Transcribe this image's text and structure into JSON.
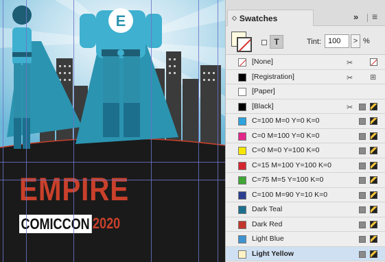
{
  "canvas": {
    "title_line1": "EMPIRE",
    "title_line2": "COMICCON",
    "title_year": "2020",
    "hero_emblem": "E"
  },
  "panel": {
    "tab_label": "Swatches",
    "tab_icon": "◇",
    "collapse_label": "»",
    "menu_label": "≡",
    "format_text_label": "T",
    "tint_label": "Tint:",
    "tint_value": "100",
    "tint_arrow": ">",
    "tint_unit": "%"
  },
  "swatches": [
    {
      "name": "[None]",
      "color": "none",
      "indicators": [
        "scissors-icon",
        "none-icon"
      ]
    },
    {
      "name": "[Registration]",
      "color": "#000000",
      "indicators": [
        "scissors-icon",
        "registration-icon"
      ]
    },
    {
      "name": "[Paper]",
      "color": "#ffffff",
      "indicators": []
    },
    {
      "name": "[Black]",
      "color": "#000000",
      "indicators": [
        "scissors-icon",
        "process-icon",
        "cmyk-icon"
      ]
    },
    {
      "name": "C=100 M=0 Y=0 K=0",
      "color": "#2ea3dc",
      "indicators": [
        "process-icon",
        "cmyk-icon"
      ]
    },
    {
      "name": "C=0 M=100 Y=0 K=0",
      "color": "#e2268a",
      "indicators": [
        "process-icon",
        "cmyk-icon"
      ]
    },
    {
      "name": "C=0 M=0 Y=100 K=0",
      "color": "#f5e600",
      "indicators": [
        "process-icon",
        "cmyk-icon"
      ]
    },
    {
      "name": "C=15 M=100 Y=100 K=0",
      "color": "#d52630",
      "indicators": [
        "process-icon",
        "cmyk-icon"
      ]
    },
    {
      "name": "C=75 M=5 Y=100 K=0",
      "color": "#3fa535",
      "indicators": [
        "process-icon",
        "cmyk-icon"
      ]
    },
    {
      "name": "C=100 M=90 Y=10 K=0",
      "color": "#2c3f8f",
      "indicators": [
        "process-icon",
        "cmyk-icon"
      ]
    },
    {
      "name": "Dark Teal",
      "color": "#1d6f8e",
      "indicators": [
        "process-icon",
        "cmyk-icon"
      ]
    },
    {
      "name": "Dark Red",
      "color": "#c2372b",
      "indicators": [
        "process-icon",
        "cmyk-icon"
      ]
    },
    {
      "name": "Light Blue",
      "color": "#3f93cf",
      "indicators": [
        "process-icon",
        "cmyk-icon"
      ]
    },
    {
      "name": "Light Yellow",
      "color": "#fff3c6",
      "indicators": [
        "process-icon",
        "cmyk-icon"
      ],
      "selected": true
    }
  ]
}
